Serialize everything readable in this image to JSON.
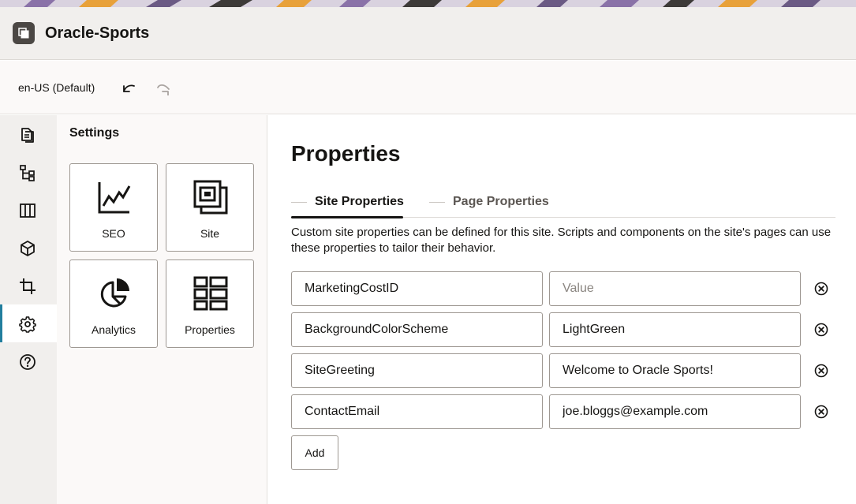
{
  "app": {
    "title": "Oracle-Sports"
  },
  "toolbar": {
    "locale": "en-US (Default)"
  },
  "rail": {
    "items": [
      {
        "icon": "pages-icon"
      },
      {
        "icon": "site-structure-icon"
      },
      {
        "icon": "themes-icon"
      },
      {
        "icon": "components-icon"
      },
      {
        "icon": "crop-icon"
      },
      {
        "icon": "gear-icon",
        "active": true
      },
      {
        "icon": "help-icon"
      }
    ]
  },
  "settings": {
    "title": "Settings",
    "tiles": [
      {
        "label": "SEO",
        "icon": "line-chart-icon"
      },
      {
        "label": "Site",
        "icon": "site-pages-icon"
      },
      {
        "label": "Analytics",
        "icon": "pie-chart-icon"
      },
      {
        "label": "Properties",
        "icon": "properties-grid-icon"
      }
    ]
  },
  "main": {
    "title": "Properties",
    "tabs": [
      {
        "label": "Site Properties",
        "active": true
      },
      {
        "label": "Page Properties",
        "active": false
      }
    ],
    "description": "Custom site properties can be defined for this site. Scripts and components on the site's pages can use these properties to tailor their behavior.",
    "properties": [
      {
        "name": "MarketingCostID",
        "value": "",
        "value_placeholder": "Value"
      },
      {
        "name": "BackgroundColorScheme",
        "value": "LightGreen"
      },
      {
        "name": "SiteGreeting",
        "value": "Welcome to Oracle Sports!"
      },
      {
        "name": "ContactEmail",
        "value": "joe.bloggs@example.com"
      }
    ],
    "add_label": "Add"
  },
  "colors": {
    "accent": "#227e9e",
    "header_bg": "#f1efed",
    "text": "#161513"
  }
}
